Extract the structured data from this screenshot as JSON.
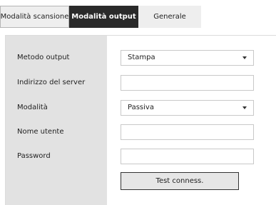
{
  "tabs": [
    {
      "label": "Modalità scansione"
    },
    {
      "label": "Modalità output"
    },
    {
      "label": "Generale"
    }
  ],
  "form": {
    "output_method": {
      "label": "Metodo output",
      "value": "Stampa"
    },
    "server_address": {
      "label": "Indirizzo del server",
      "value": ""
    },
    "mode": {
      "label": "Modalità",
      "value": "Passiva"
    },
    "username": {
      "label": "Nome utente",
      "value": ""
    },
    "password": {
      "label": "Password",
      "value": ""
    }
  },
  "actions": {
    "test_connection": "Test conness."
  },
  "colors": {
    "active_tab": "#2a2a2a",
    "label_column": "#e2e2e2",
    "button": "#e6e6e6"
  }
}
